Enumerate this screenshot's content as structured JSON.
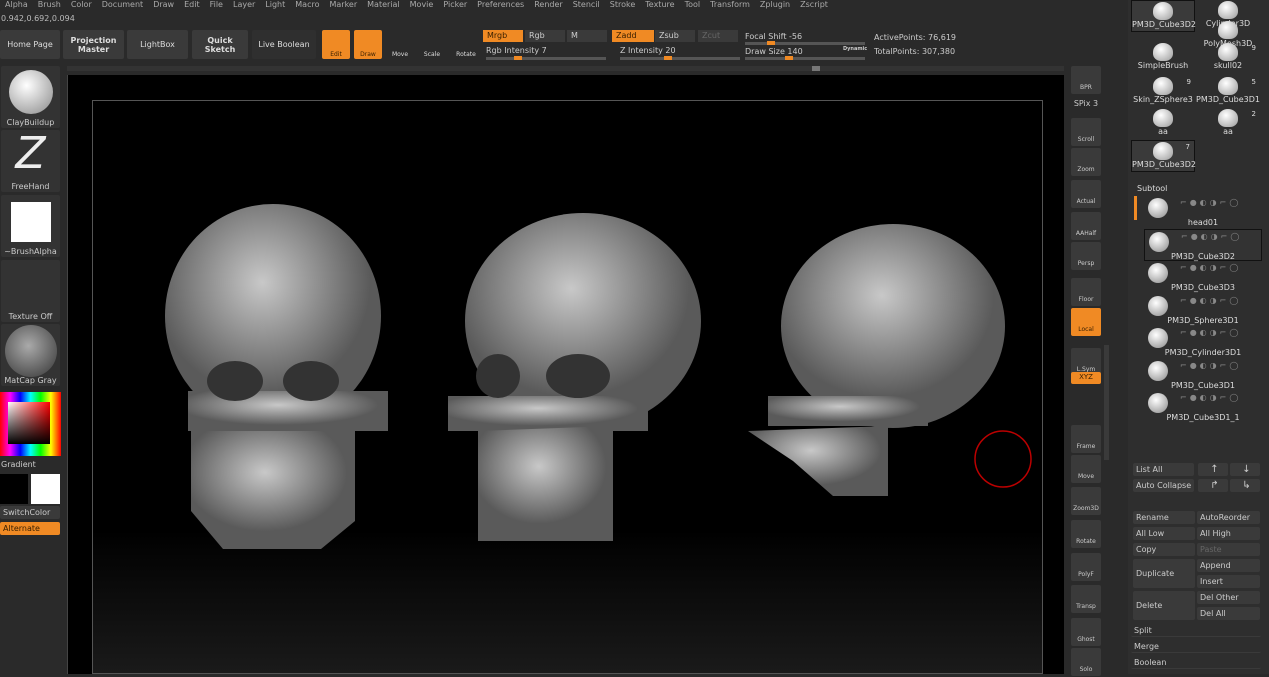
{
  "menu": [
    "Alpha",
    "Brush",
    "Color",
    "Document",
    "Draw",
    "Edit",
    "File",
    "Layer",
    "Light",
    "Macro",
    "Marker",
    "Material",
    "Movie",
    "Picker",
    "Preferences",
    "Render",
    "Stencil",
    "Stroke",
    "Texture",
    "Tool",
    "Transform",
    "Zplugin",
    "Zscript"
  ],
  "coords": "0.942,0.692,0.094",
  "toolbar": {
    "home": "Home Page",
    "projection": "Projection Master",
    "lightbox": "LightBox",
    "quick_sketch": "Quick Sketch",
    "live_boolean": "Live Boolean",
    "edit": "Edit",
    "draw": "Draw",
    "move": "Move",
    "scale": "Scale",
    "rotate": "Rotate",
    "mrgb": "Mrgb",
    "rgb": "Rgb",
    "m": "M",
    "zadd": "Zadd",
    "zsub": "Zsub",
    "zcut": "Zcut",
    "rgb_intensity": "Rgb Intensity 7",
    "z_intensity": "Z Intensity 20",
    "focal_shift": "Focal Shift -56",
    "draw_size": "Draw Size 140",
    "dynamic": "Dynamic",
    "active_points": "ActivePoints: 76,619",
    "total_points": "TotalPoints: 307,380"
  },
  "slider_values": {
    "rgb_intensity": 7,
    "z_intensity": 20,
    "focal_shift": -56,
    "draw_size": 140
  },
  "left": {
    "brush": "ClayBuildup",
    "stroke": "FreeHand",
    "alpha": "~BrushAlpha",
    "texture": "Texture Off",
    "material": "MatCap Gray",
    "gradient": "Gradient",
    "switch_color": "SwitchColor",
    "alternate": "Alternate"
  },
  "shelf": [
    "BPR",
    "SPix 3",
    "Scroll",
    "Zoom",
    "Actual",
    "AAHalf",
    "Persp",
    "Floor",
    "Local",
    "L.Sym",
    "XYZ",
    "Frame",
    "Move",
    "Zoom3D",
    "Rotate",
    "PolyF",
    "Transp",
    "Ghost",
    "Solo"
  ],
  "tools": [
    {
      "name": "PM3D_Cube3D2",
      "count": ""
    },
    {
      "name": "Cylinder3D",
      "count": ""
    },
    {
      "name": "SimpleBrush",
      "count": ""
    },
    {
      "name": "PolyMesh3D",
      "count": ""
    },
    {
      "name": "skull02",
      "count": "9"
    },
    {
      "name": "Skin_ZSphere3",
      "count": "9"
    },
    {
      "name": "PM3D_Cube3D1",
      "count": "5"
    },
    {
      "name": "aa",
      "count": ""
    },
    {
      "name": "aa",
      "count": "2"
    },
    {
      "name": "PM3D_Cube3D2",
      "count": "7"
    }
  ],
  "subtool": {
    "title": "Subtool",
    "items": [
      "head01",
      "PM3D_Cube3D2",
      "PM3D_Cube3D3",
      "PM3D_Sphere3D1",
      "PM3D_Cylinder3D1",
      "PM3D_Cube3D1",
      "PM3D_Cube3D1_1"
    ],
    "selected": 1
  },
  "subtool_buttons": {
    "list_all": "List All",
    "auto_collapse": "Auto Collapse",
    "rename": "Rename",
    "auto_reorder": "AutoReorder",
    "all_low": "All Low",
    "all_high": "All High",
    "copy": "Copy",
    "paste": "Paste",
    "duplicate": "Duplicate",
    "append": "Append",
    "insert": "Insert",
    "delete": "Delete",
    "del_other": "Del Other",
    "del_all": "Del All",
    "split": "Split",
    "merge": "Merge",
    "boolean": "Boolean"
  },
  "colors": {
    "accent": "#f08a24",
    "bg": "#2a2a2a"
  }
}
